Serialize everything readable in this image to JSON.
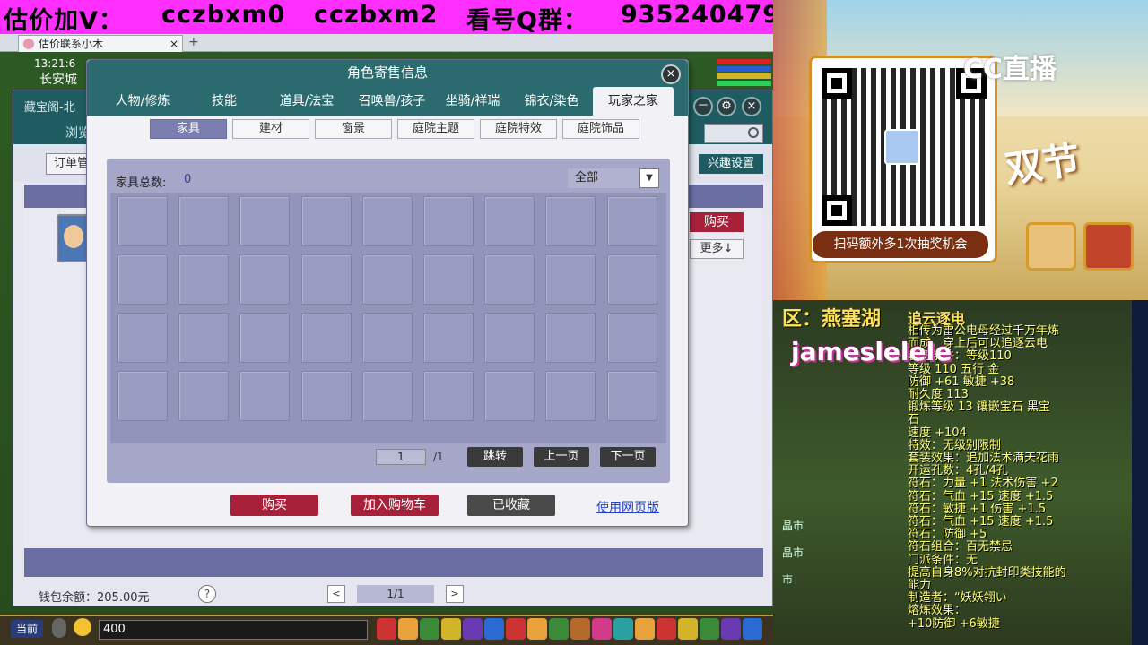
{
  "banner": {
    "part1": "估价加V：",
    "part2": "cczbxm0",
    "part3": "cczbxm2",
    "part4": "看号Q群：",
    "part5": "935240479"
  },
  "browser": {
    "tab_title": "估价联系小木",
    "close": "×",
    "add": "+"
  },
  "hud": {
    "time": "13:21:6",
    "city": "长安城"
  },
  "cbg": {
    "title": "藏宝阁-北",
    "browse": "浏览",
    "order": "订单管",
    "interest": "兴趣设置",
    "buy": "购买",
    "more": "更多↓",
    "wallet": "钱包余额：205.00元",
    "help": "?",
    "page": "1/1",
    "prev": "<",
    "next": ">",
    "min": "－",
    "settings": "⚙",
    "close": "×"
  },
  "modal": {
    "title": "角色寄售信息",
    "close": "×",
    "tabs": [
      "人物/修炼",
      "技能",
      "道具/法宝",
      "召唤兽/孩子",
      "坐骑/祥瑞",
      "锦衣/染色",
      "玩家之家"
    ],
    "active_tab": 6,
    "subtabs": [
      "家具",
      "建材",
      "窗景",
      "庭院主题",
      "庭院特效",
      "庭院饰品"
    ],
    "active_subtab": 0,
    "total_label": "家具总数:",
    "total_value": "0",
    "filter_value": "全部",
    "filter_arrow": "▼",
    "grid_rows": 4,
    "grid_cols": 9,
    "page_input": "1",
    "page_total": "/1",
    "jump": "跳转",
    "prev_page": "上一页",
    "next_page": "下一页",
    "buy": "购买",
    "add_cart": "加入购物车",
    "collected": "已收藏",
    "old_version": "使用网页版"
  },
  "gamebar": {
    "channel": "当前",
    "input_value": "400"
  },
  "promo": {
    "logo": "CC直播",
    "caption": "扫码额外多1次抽奖机会",
    "art_text": "双节"
  },
  "stream": {
    "region": "区：燕塞湖",
    "viewer": "jameslelele",
    "item_title": "追云逐电",
    "item_lines": [
      "相传为雷公电母经过千万年炼",
      "而成，穿上后可以追逐云电",
      "装备条件：等级110",
      "等级 110  五行 金",
      "防御 +61 敏捷 +38",
      "耐久度 113",
      "锻炼等级 13  镶嵌宝石 黑宝",
      "石",
      "速度 +104",
      "特效：无级别限制",
      "套装效果：追加法术满天花雨",
      "开运孔数：4孔/4孔",
      "符石：力量 +1 法术伤害 +2",
      "符石：气血 +15 速度 +1.5",
      "符石：敏捷 +1 伤害 +1.5",
      "符石：气血 +15 速度 +1.5",
      "符石：防御 +5",
      "符石组合：百无禁忌",
      "门派条件：无",
      "提高自身8%对抗封印类技能的",
      "能力",
      "制造者：“妖妖翎い",
      "熔炼效果：",
      "+10防御 +6敏捷"
    ],
    "shop1": "晶市",
    "shop2": "晶市",
    "shop3": "市"
  },
  "colors": {
    "banner": "#ff2fff",
    "teal": "#2b6b6f",
    "purple": "#7b7eaf",
    "buy_red": "#a8213a",
    "dark_btn": "#3a3a3a",
    "link": "#2040d0"
  }
}
